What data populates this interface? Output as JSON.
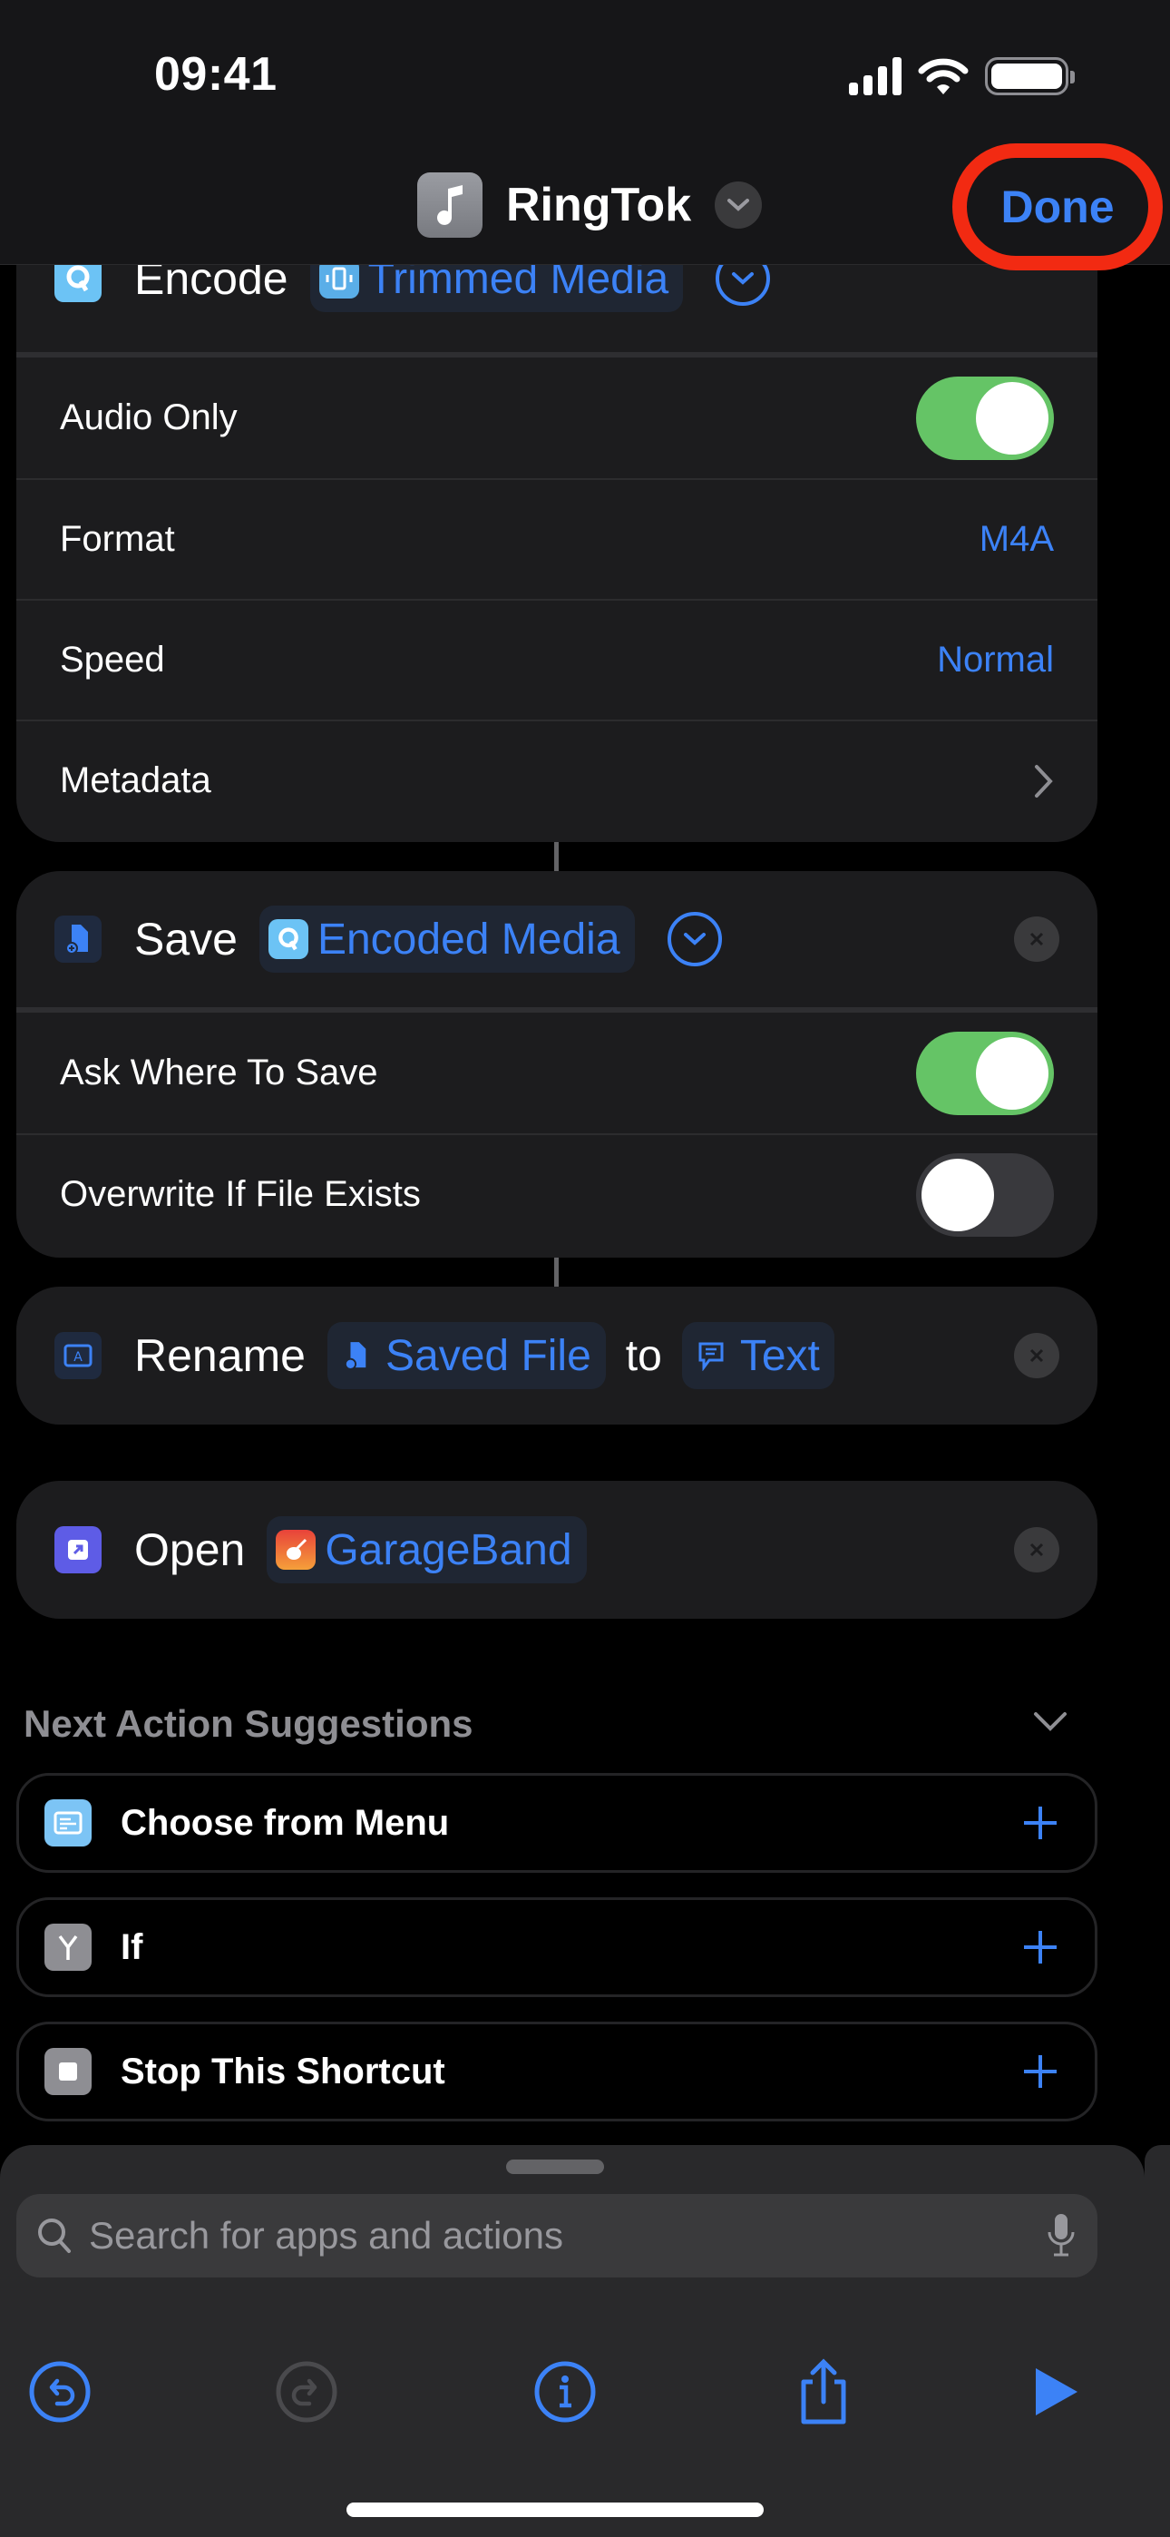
{
  "status_bar": {
    "time": "09:41"
  },
  "nav": {
    "title": "RingTok",
    "app_icon": "music-note-icon",
    "done_label": "Done",
    "annotation_color": "#f22a12"
  },
  "colors": {
    "accent": "#3c82f6",
    "toggle_on": "#65c466",
    "card": "#1c1c1e"
  },
  "actions": [
    {
      "verb": "Encode",
      "icon": "quicktime-icon",
      "token": {
        "label": "Trimmed Media",
        "icon": "trim-media-icon"
      },
      "params": [
        {
          "label": "Audio Only",
          "type": "toggle",
          "on": true
        },
        {
          "label": "Format",
          "type": "value",
          "value": "M4A"
        },
        {
          "label": "Speed",
          "type": "value",
          "value": "Normal"
        },
        {
          "label": "Metadata",
          "type": "disclosure"
        }
      ]
    },
    {
      "verb": "Save",
      "icon": "save-file-icon",
      "token": {
        "label": "Encoded Media",
        "icon": "quicktime-icon"
      },
      "params": [
        {
          "label": "Ask Where To Save",
          "type": "toggle",
          "on": true
        },
        {
          "label": "Overwrite If File Exists",
          "type": "toggle",
          "on": false
        }
      ]
    },
    {
      "verb": "Rename",
      "icon": "rename-icon",
      "token": {
        "label": "Saved File",
        "icon": "save-file-icon"
      },
      "connector_word": "to",
      "token2": {
        "label": "Text",
        "icon": "text-bubble-icon"
      }
    },
    {
      "verb": "Open",
      "icon": "open-app-icon",
      "token": {
        "label": "GarageBand",
        "icon": "garageband-icon"
      }
    }
  ],
  "suggestions": {
    "title": "Next Action Suggestions",
    "items": [
      {
        "label": "Choose from Menu",
        "icon": "menu-icon"
      },
      {
        "label": "If",
        "icon": "branch-icon"
      },
      {
        "label": "Stop This Shortcut",
        "icon": "stop-icon"
      }
    ]
  },
  "search": {
    "placeholder": "Search for apps and actions",
    "value": ""
  },
  "toolbar": {
    "buttons": [
      "undo",
      "redo",
      "info",
      "share",
      "run"
    ]
  }
}
